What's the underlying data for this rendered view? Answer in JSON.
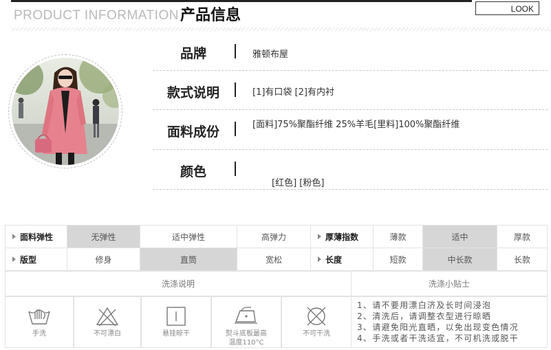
{
  "header": {
    "title_en": "PRODUCT INFORMATION",
    "title_zh": "产品信息",
    "look_label": "LOOK"
  },
  "specs": [
    {
      "label": "品牌",
      "value": "雅顿布屋"
    },
    {
      "label": "款式说明",
      "value": "[1]有口袋 [2]有内衬"
    },
    {
      "label": "面料成份",
      "value": "[面料]75%聚酯纤维 25%羊毛[里料]100%聚酯纤维"
    },
    {
      "label": "颜色",
      "value": "[红色] [粉色]"
    }
  ],
  "attributes": {
    "rows": [
      {
        "left_head": "面料弹性",
        "left_options": [
          "无弹性",
          "适中弹性",
          "高弹力"
        ],
        "left_selected": 0,
        "right_head": "厚薄指数",
        "right_options": [
          "薄款",
          "适中",
          "厚款"
        ],
        "right_selected": 1
      },
      {
        "left_head": "版型",
        "left_options": [
          "修身",
          "直筒",
          "宽松"
        ],
        "left_selected": 1,
        "right_head": "长度",
        "right_options": [
          "短款",
          "中长款",
          "长款"
        ],
        "right_selected": 1
      }
    ],
    "selected_color": "#d6d6d6"
  },
  "wash": {
    "instructions_title": "洗涤说明",
    "tips_title": "洗涤小贴士",
    "icons": [
      {
        "name": "hand-wash-icon",
        "caption": "手洗"
      },
      {
        "name": "no-bleach-icon",
        "caption": "不可漂白"
      },
      {
        "name": "hang-dry-icon",
        "caption": "悬挂晾干"
      },
      {
        "name": "iron-icon",
        "caption": "熨斗底板最高",
        "caption2": "温度110°C"
      },
      {
        "name": "no-dry-clean-icon",
        "caption": "不可干洗"
      }
    ],
    "tips": [
      "1、请不要用漂白济及长时间浸泡",
      "2、清洗后，请调整衣型进行晾晒",
      "3、请避免阳光直晒，以免出现变色情况",
      "4、手洗或者干洗适宜，不可机洗或脱干"
    ]
  }
}
